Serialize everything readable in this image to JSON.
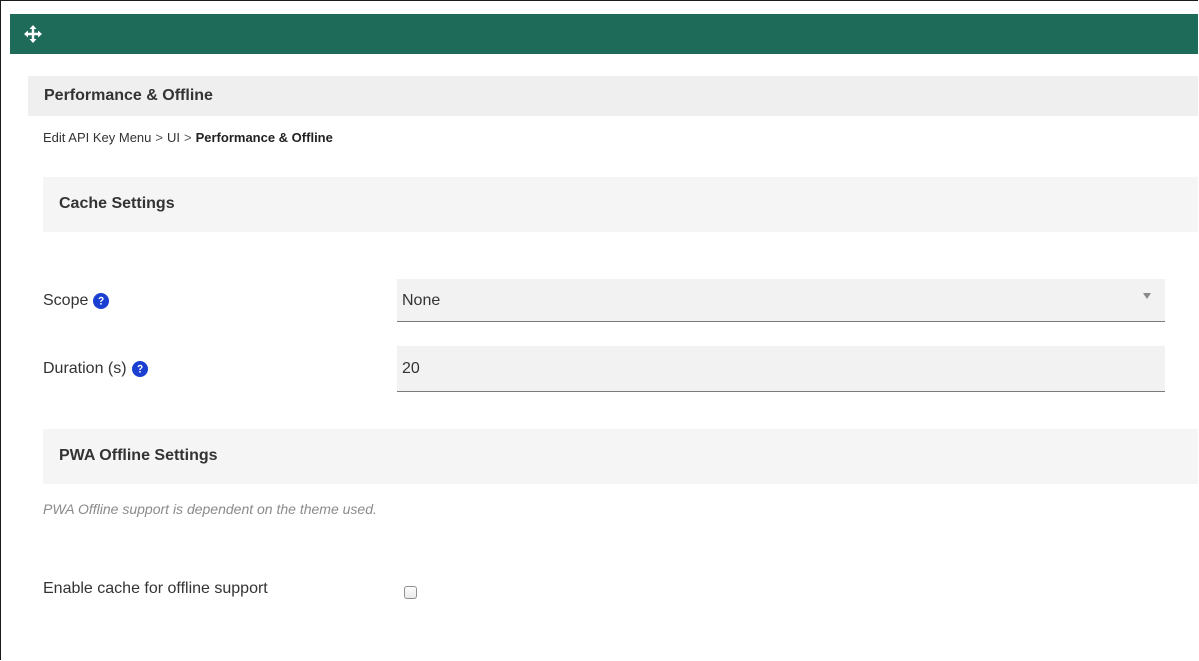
{
  "toolbar": {
    "icon": "move-icon",
    "color": "#1f6b5a"
  },
  "panel": {
    "title": "Performance & Offline"
  },
  "breadcrumb": {
    "items": [
      "Edit API Key Menu",
      "UI"
    ],
    "separator": ">",
    "current": "Performance & Offline"
  },
  "cache_settings": {
    "title": "Cache Settings",
    "scope": {
      "label": "Scope",
      "value": "None",
      "help_icon": "question-circle-icon"
    },
    "duration": {
      "label": "Duration (s)",
      "value": "20",
      "help_icon": "question-circle-icon"
    }
  },
  "pwa_settings": {
    "title": "PWA Offline Settings",
    "note": "PWA Offline support is dependent on the theme used.",
    "offline_cache": {
      "label": "Enable cache for offline support",
      "checked": false
    }
  },
  "colors": {
    "accent": "#1f6b5a",
    "help_icon": "#1a3fd1"
  }
}
